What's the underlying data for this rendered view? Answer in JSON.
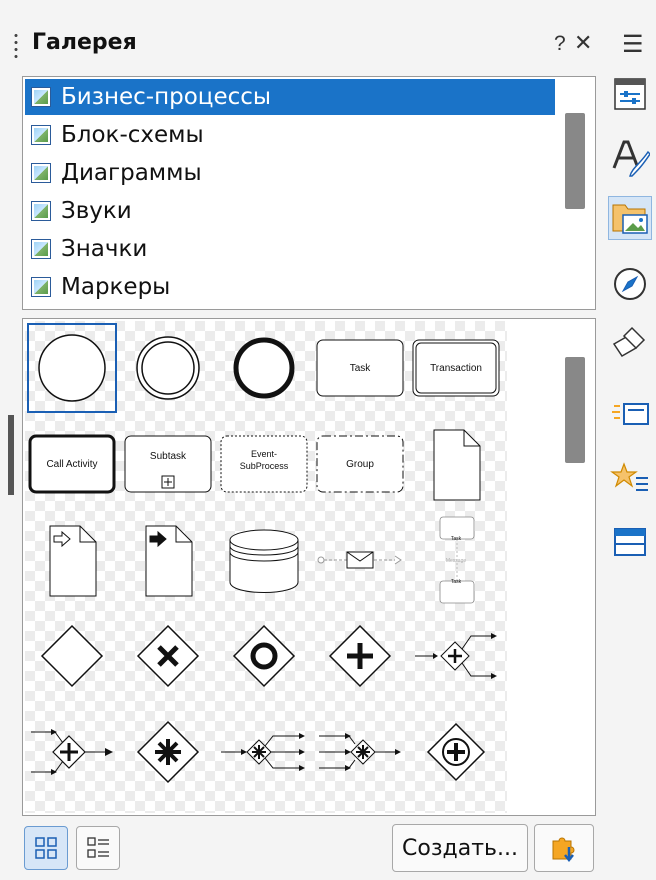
{
  "header": {
    "title": "Галерея",
    "help": "?",
    "close": "✕"
  },
  "categories": [
    {
      "label": "Бизнес-процессы",
      "selected": true
    },
    {
      "label": "Блок-схемы",
      "selected": false
    },
    {
      "label": "Диаграммы",
      "selected": false
    },
    {
      "label": "Звуки",
      "selected": false
    },
    {
      "label": "Значки",
      "selected": false
    },
    {
      "label": "Маркеры",
      "selected": false
    }
  ],
  "thumbnails": {
    "task": "Task",
    "transaction": "Transaction",
    "call_activity": "Call Activity",
    "subtask": "Subtask",
    "event_line1": "Event-",
    "event_line2": "SubProcess",
    "group": "Group",
    "mini_task1": "Task",
    "mini_message": "Message",
    "mini_task2": "Task"
  },
  "footer": {
    "create_label": "Создать..."
  },
  "sidebar": {
    "menu": "☰"
  },
  "colors": {
    "accent": "#1a73c8",
    "sidebar_active": "#d5e5f6"
  }
}
